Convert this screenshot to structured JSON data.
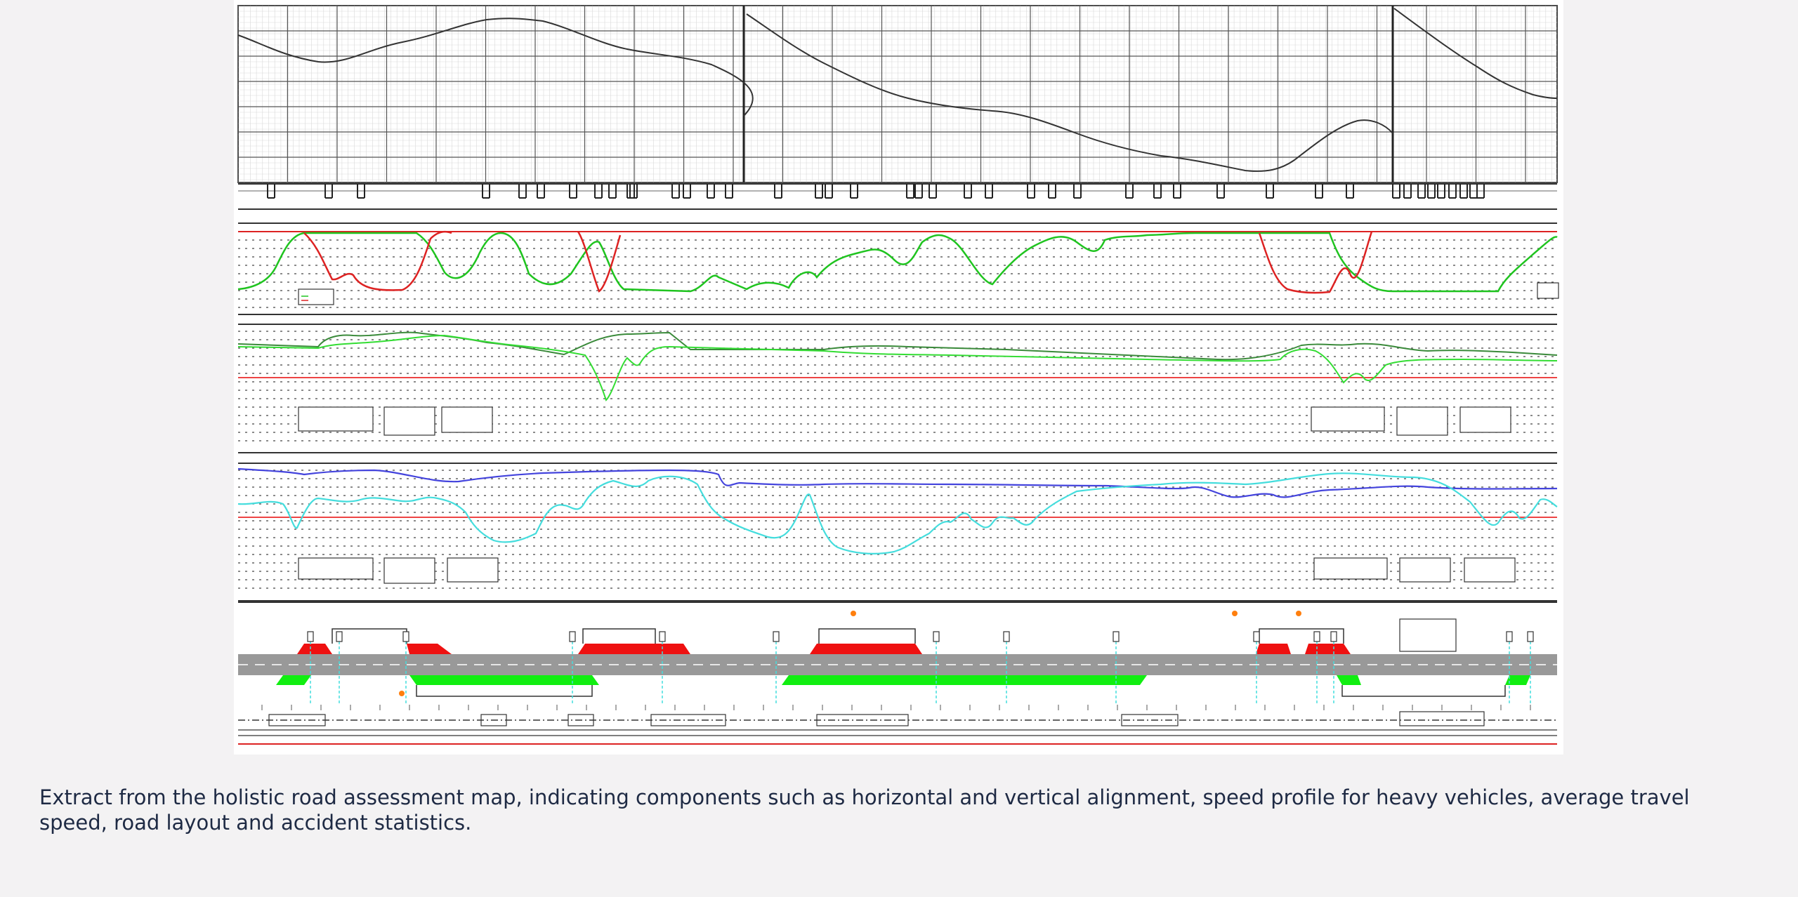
{
  "figure": {
    "alt": "holistic road assessment map extract",
    "colors": {
      "grid": "#bdbdbd",
      "alignment_line": "#333333",
      "speed_ok": "#1fc41f",
      "speed_bad": "#dd2222",
      "avg_speed_dark": "#3a9a3a",
      "avg_speed_light": "#33dd33",
      "limit_line": "#ee4444",
      "travel_blue": "#4444dd",
      "travel_cyan": "#44dddd",
      "road_grey": "#9a9a9a",
      "red_zone": "#ee1111",
      "green_zone": "#11ee11",
      "marker_orange": "#ff7f0e"
    }
  },
  "caption": {
    "text": "Extract from the holistic road assessment map, indicating components such as horizontal and vertical alignment, speed profile for heavy vehicles, average travel speed, road layout and accident statistics."
  }
}
